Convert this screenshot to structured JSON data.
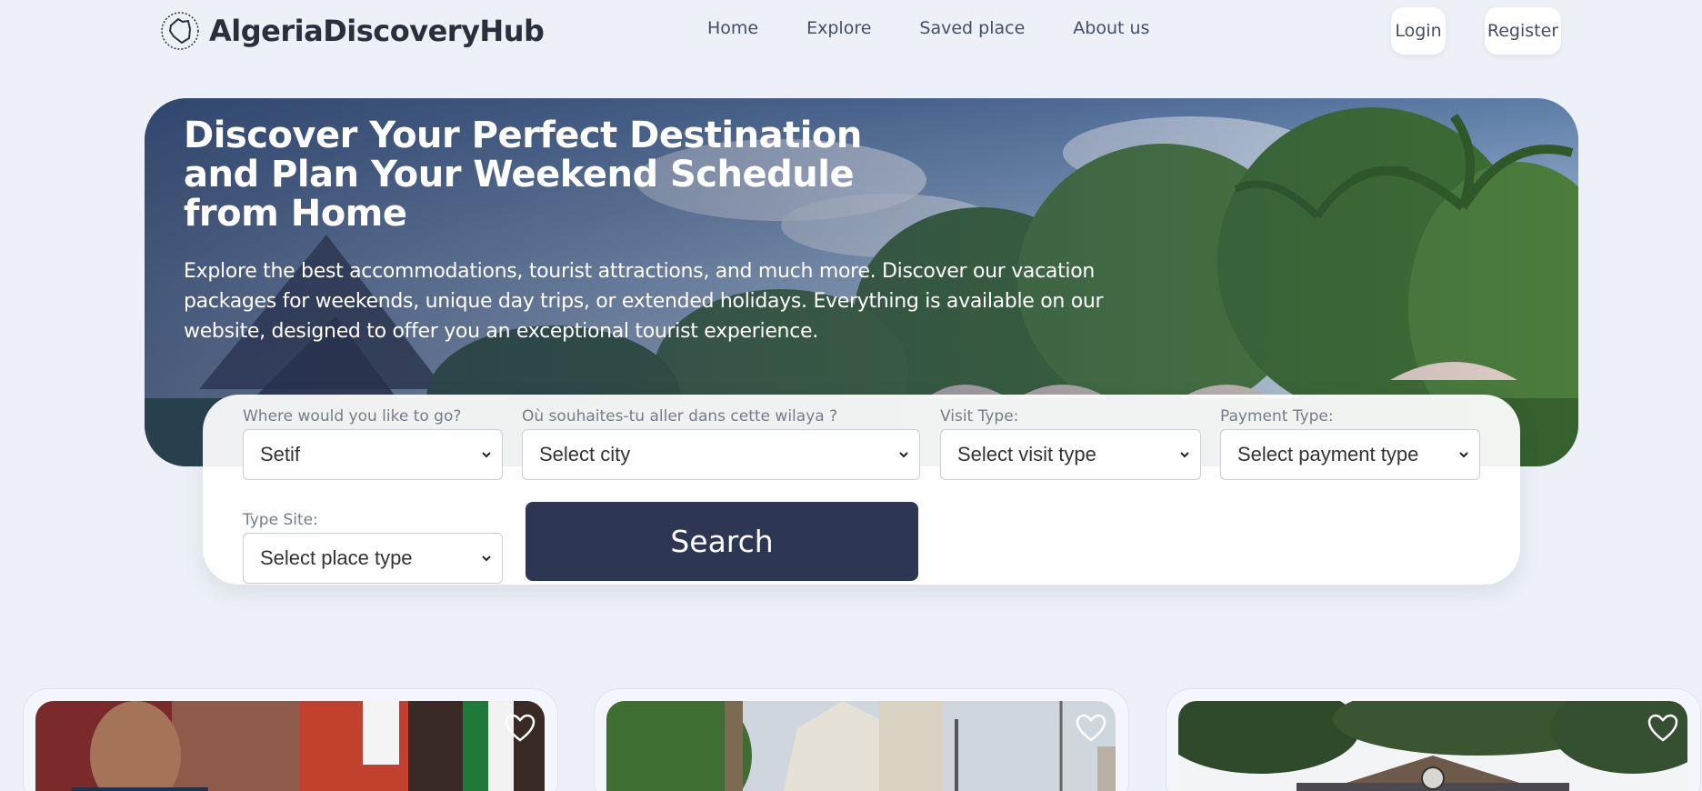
{
  "brand": {
    "name": "AlgeriaDiscoveryHub",
    "icon": "algeria-map-icon"
  },
  "nav": {
    "links": [
      "Home",
      "Explore",
      "Saved place",
      "About us"
    ],
    "login": "Login",
    "register": "Register"
  },
  "hero": {
    "title": "Discover Your Perfect Destination and Plan Your Weekend Schedule from Home",
    "description": "Explore the best accommodations, tourist attractions, and much more. Discover our vacation packages for weekends, unique day trips, or extended holidays. Everything is available on our website, designed to offer you an exceptional tourist experience."
  },
  "search": {
    "wilaya": {
      "label": "Where would you like to go?",
      "value": "Setif"
    },
    "city": {
      "label": "Où souhaites-tu aller dans cette wilaya ?",
      "value": "Select city"
    },
    "visit_type": {
      "label": "Visit Type:",
      "value": "Select visit type"
    },
    "payment_type": {
      "label": "Payment Type:",
      "value": "Select payment type"
    },
    "site_type": {
      "label": "Type Site:",
      "value": "Select place type"
    },
    "button": "Search"
  },
  "colors": {
    "background": "#edf0f7",
    "primary": "#2d3753",
    "text": "#2a2f3e"
  },
  "cards": [
    {
      "icon": "heart-icon"
    },
    {
      "icon": "heart-icon"
    },
    {
      "icon": "heart-icon"
    }
  ]
}
